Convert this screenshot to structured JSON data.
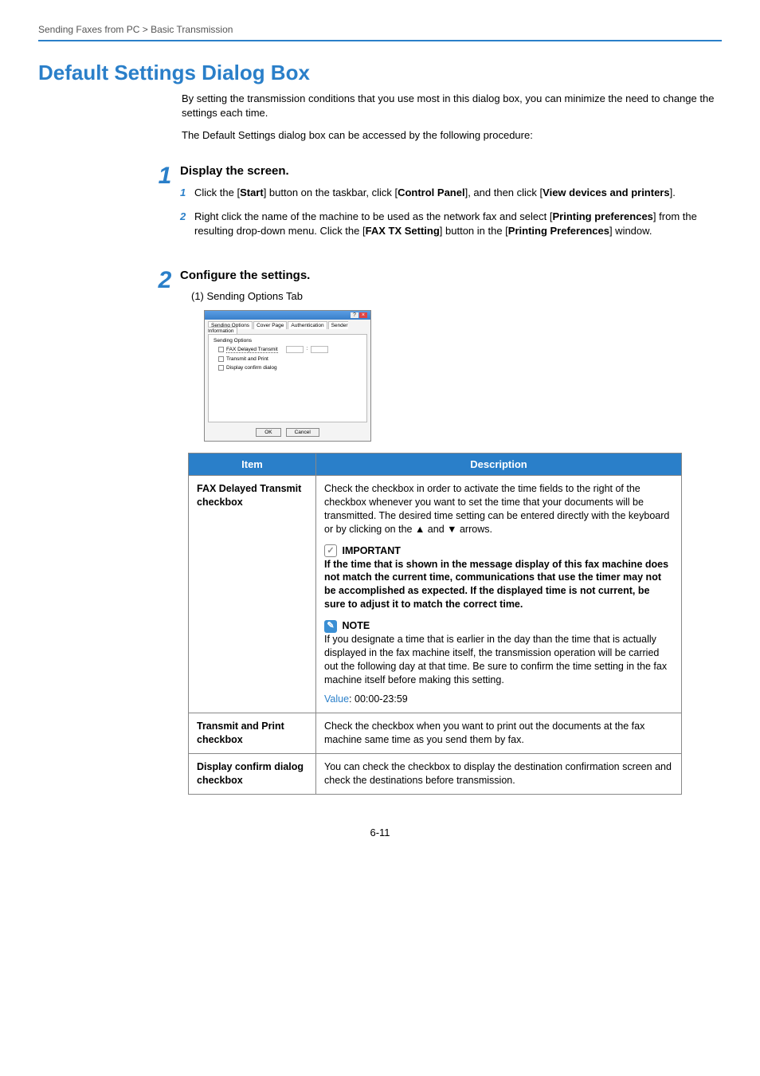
{
  "breadcrumb": "Sending Faxes from PC > Basic Transmission",
  "h1": "Default Settings Dialog Box",
  "intro1": "By setting the transmission conditions that you use most in this dialog box, you can minimize the need to change the settings each time.",
  "intro2": "The Default Settings dialog box can be accessed by the following procedure:",
  "step1": {
    "num": "1",
    "title": "Display the screen.",
    "sub1": {
      "num": "1",
      "pre": "Click the [",
      "b1": "Start",
      "mid1": "] button on the taskbar, click [",
      "b2": "Control Panel",
      "mid2": "], and then click [",
      "b3": "View devices and printers",
      "post": "]."
    },
    "sub2": {
      "num": "2",
      "pre": "Right click the name of the machine to be used as the network fax and select [",
      "b1": "Printing preferences",
      "mid1": "] from the resulting drop-down menu. Click the [",
      "b2": "FAX TX Setting",
      "mid2": "] button in the [",
      "b3": "Printing Preferences",
      "post": "] window."
    }
  },
  "step2": {
    "num": "2",
    "title": "Configure the settings.",
    "caption": "(1) Sending Options Tab"
  },
  "screenshot": {
    "tabs": {
      "t1": "Sending Options",
      "t2": "Cover Page",
      "t3": "Authentication",
      "t4": "Sender Information"
    },
    "group": "Sending Options",
    "cb1": "FAX Delayed Transmit",
    "cb2": "Transmit and Print",
    "cb3": "Display confirm dialog",
    "ok": "OK",
    "cancel": "Cancel"
  },
  "table": {
    "head": {
      "item": "Item",
      "desc": "Description"
    },
    "row1": {
      "item": "FAX Delayed Transmit checkbox",
      "desc": "Check the checkbox in order to activate the time fields to the right of the checkbox whenever you want to set the time that your documents will be transmitted. The desired time setting can be entered directly with the keyboard or by clicking on the ▲ and ▼ arrows.",
      "important_label": "IMPORTANT",
      "important_body": "If the time that is shown in the message display of this fax machine does not match the current time, communications that use the timer may not be accomplished as expected. If the displayed time is not current, be sure to adjust it to match the correct time.",
      "note_label": "NOTE",
      "note_body": "If you designate a time that is earlier in the day than the time that is actually displayed in the fax machine itself, the transmission operation will be carried out the following day at that time. Be sure to confirm the time setting in the fax machine itself before making this setting.",
      "value_label": "Value",
      "value_sep": ": ",
      "value": "00:00-23:59"
    },
    "row2": {
      "item": "Transmit and Print checkbox",
      "desc": "Check the checkbox when you want to print out the documents at the fax machine same time as you send them by fax."
    },
    "row3": {
      "item": "Display confirm dialog checkbox",
      "desc": "You can check the checkbox to display the destination confirmation screen and check the destinations before transmission."
    }
  },
  "page_num": "6-11"
}
